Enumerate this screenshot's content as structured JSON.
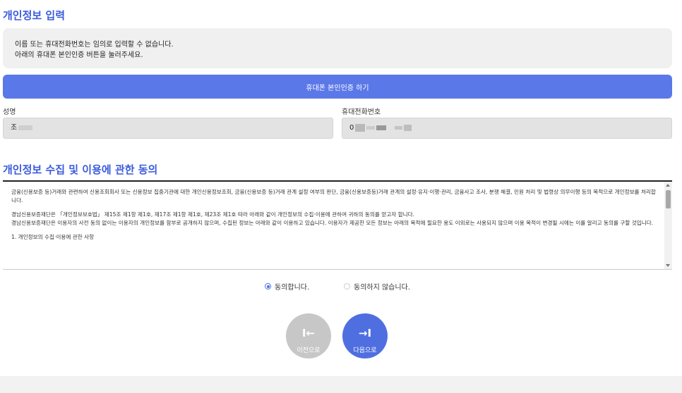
{
  "personal_info": {
    "title": "개인정보 입력",
    "notice_line1": "이름 또는 휴대전화번호는 임의로 입력할 수 없습니다.",
    "notice_line2": "아래의 휴대폰 본인인증 버튼을 눌러주세요.",
    "verify_button": "휴대폰 본인인증 하기",
    "name_label": "성명",
    "name_value": "조",
    "phone_label": "휴대전화번호",
    "phone_value": "0"
  },
  "consent": {
    "title": "개인정보 수집 및 이용에 관한 동의",
    "terms": {
      "p1": "금융(신용보증 등)거래와 관련하여 신용조회회사 또는 신용정보 집중기관에 대한 개인신용정보조회, 금융(신용보증 등)거래 관계 설정 여부의 판단, 금융(신용보증등)거래 관계의 설정·유지·이행·관리, 금융사고 조사, 분쟁 해결, 민원 처리 및 법령상 의무이행 등의 목적으로 개인정보를 처리합니다.",
      "p2_line1": "경남신용보증재단은 「개인정보보호법」 제15조 제1항 제1호, 제17조 제1항 제1호, 제23조 제1호 따라 아래와 같이 개인정보의 수집·이용에 관하여 귀하의 동의를 얻고자 합니다.",
      "p2_line2": "경남신용보증재단은 이용자의 사전 동의 없이는 이용자의 개인정보를 함부로 공개하지 않으며, 수집된 정보는 아래와 같이 이용하고 있습니다. 이용자가 제공한 모든 정보는 아래의 목적에 필요한 용도 이외로는 사용되지 않으며 이용 목적이 변경될 시에는 이를 알리고 동의를 구할 것입니다.",
      "p3": "1. 개인정보의 수집·이용에 관한 사항"
    },
    "agree_label": "동의합니다.",
    "disagree_label": "동의하지 않습니다.",
    "selected": "agree"
  },
  "navigation": {
    "prev_label": "이전으로",
    "prev_icon": "I←",
    "next_label": "다음으로",
    "next_icon": "→I"
  }
}
